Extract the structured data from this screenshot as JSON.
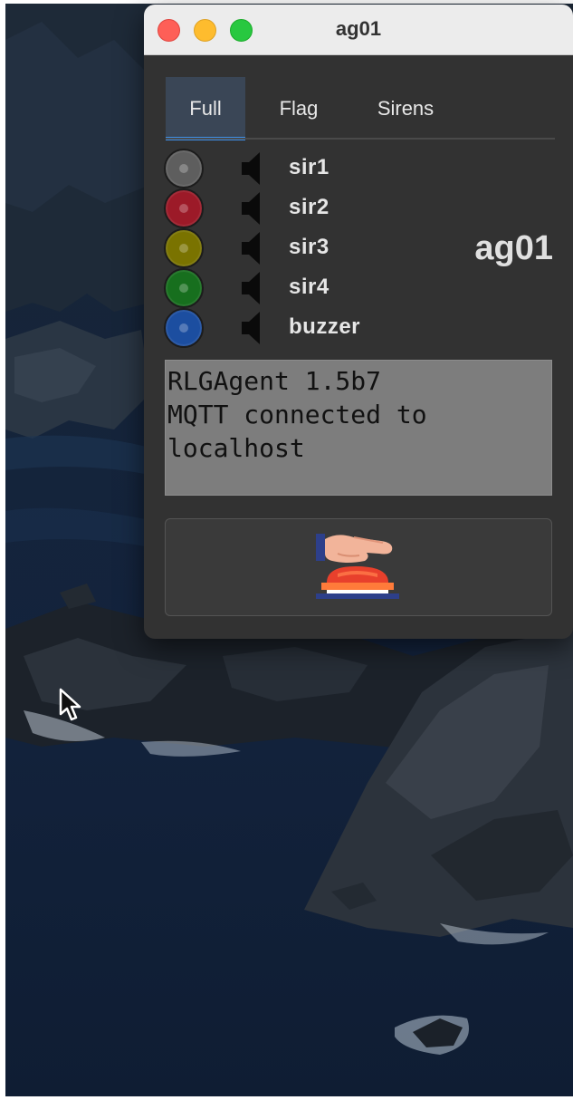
{
  "window": {
    "title": "ag01",
    "traffic_lights": [
      "close",
      "minimize",
      "zoom"
    ]
  },
  "tabs": [
    {
      "label": "Full",
      "selected": true
    },
    {
      "label": "Flag",
      "selected": false
    },
    {
      "label": "Sirens",
      "selected": false
    }
  ],
  "sirens": [
    {
      "label": "sir1",
      "led_color": "#5e5e5e",
      "icon": "speaker-icon"
    },
    {
      "label": "sir2",
      "led_color": "#9c1a28",
      "icon": "speaker-icon"
    },
    {
      "label": "sir3",
      "led_color": "#7a7300",
      "icon": "speaker-icon"
    },
    {
      "label": "sir4",
      "led_color": "#176f1e",
      "icon": "speaker-icon"
    },
    {
      "label": "buzzer",
      "led_color": "#1c4ea0",
      "icon": "speaker-icon"
    }
  ],
  "agent_name": "ag01",
  "log": {
    "lines": [
      "RLGAgent 1.5b7",
      "MQTT connected to",
      "localhost"
    ]
  },
  "panic_button": {
    "icon": "hand-pressing-red-button-icon"
  },
  "colors": {
    "accent": "#3d8ee6",
    "window_bg": "#323232",
    "log_bg": "#7d7d7d"
  }
}
